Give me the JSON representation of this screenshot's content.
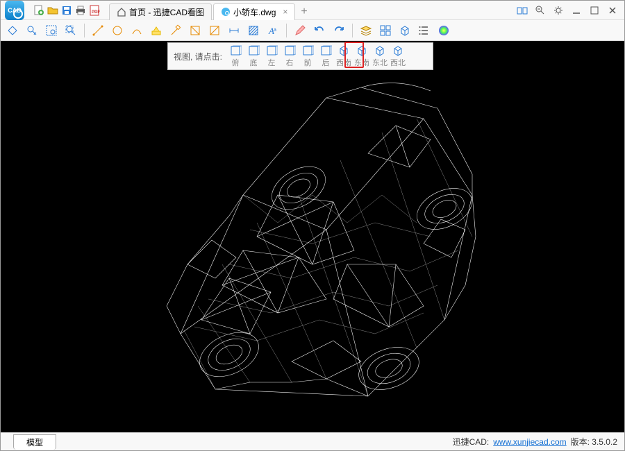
{
  "tabs": {
    "home_label": "首页 - 迅捷CAD看图",
    "file_label": "小轿车.dwg",
    "close_glyph": "×",
    "plus_glyph": "+"
  },
  "view_popup": {
    "label": "视图, 请点击:",
    "items": [
      {
        "label": "俯"
      },
      {
        "label": "底"
      },
      {
        "label": "左"
      },
      {
        "label": "右"
      },
      {
        "label": "前"
      },
      {
        "label": "后"
      },
      {
        "label": "西南"
      },
      {
        "label": "东南"
      },
      {
        "label": "东北"
      },
      {
        "label": "西北"
      }
    ],
    "highlighted_index": 6
  },
  "statusbar": {
    "model_tab": "模型",
    "brand": "迅捷CAD:",
    "url_text": "www.xunjiecad.com",
    "version_label": "版本: 3.5.0.2"
  },
  "quick_icons": [
    "new-file",
    "open-file",
    "save",
    "print",
    "pdf"
  ],
  "win_icons": [
    "dual-window",
    "zoom-out",
    "settings",
    "minimize",
    "maximize",
    "close"
  ],
  "toolbar_groups": [
    [
      "pan",
      "zoom-direction",
      "zoom-window",
      "zoom-full"
    ],
    [
      "line",
      "circle",
      "arc",
      "highlight",
      "erase-line",
      "door",
      "door2",
      "dimension",
      "hatch",
      "text"
    ],
    [
      "pencil",
      "undo",
      "redo"
    ],
    [
      "layers",
      "views",
      "cube-3d",
      "list",
      "palette"
    ]
  ],
  "colors": {
    "accent": "#1e88e5",
    "highlight": "#d22",
    "icon_blue": "#2a7bd6",
    "icon_orange": "#e68a00"
  }
}
